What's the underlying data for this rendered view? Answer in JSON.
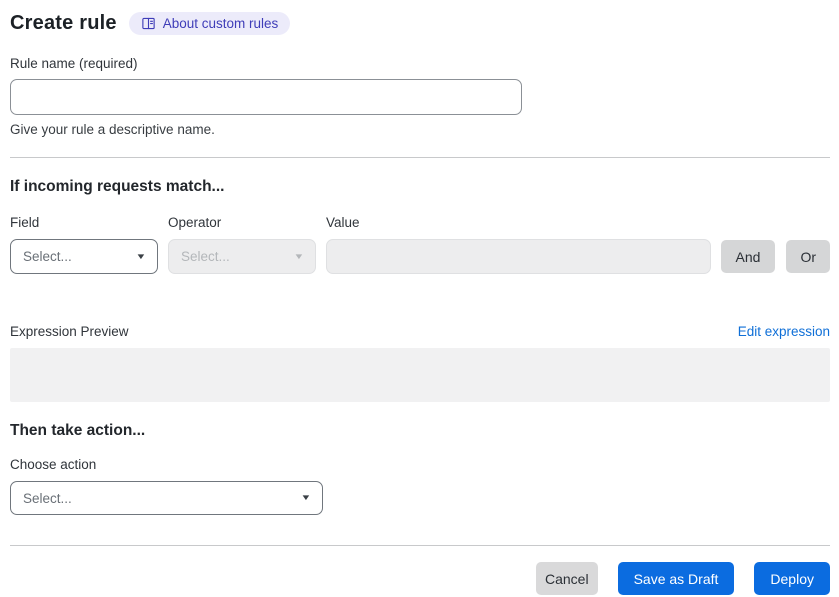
{
  "header": {
    "title": "Create rule",
    "about_badge_label": "About custom rules"
  },
  "rule_name": {
    "label": "Rule name (required)",
    "value": "",
    "placeholder": "",
    "helper": "Give your rule a descriptive name."
  },
  "match_section": {
    "heading": "If incoming requests match...",
    "field_label": "Field",
    "operator_label": "Operator",
    "value_label": "Value",
    "field_select_value": "Select...",
    "operator_select_value": "Select...",
    "value_input_value": "",
    "and_button_label": "And",
    "or_button_label": "Or"
  },
  "expression": {
    "label": "Expression Preview",
    "edit_link_label": "Edit expression",
    "preview_value": ""
  },
  "action_section": {
    "heading": "Then take action...",
    "choose_label": "Choose action",
    "action_select_value": "Select..."
  },
  "footer": {
    "cancel_label": "Cancel",
    "save_draft_label": "Save as Draft",
    "deploy_label": "Deploy"
  },
  "icons": {
    "badge_icon": "book-icon",
    "dropdown_icon": "chevron-down-icon"
  },
  "colors": {
    "primary_blue": "#0b6ce0",
    "link_blue": "#0f6fd7",
    "badge_background": "#ecebfa",
    "badge_text": "#3f3db8",
    "disabled_background": "#ededee",
    "preview_background": "#f1f1f2",
    "gray_button_background": "#d5d6d7"
  }
}
